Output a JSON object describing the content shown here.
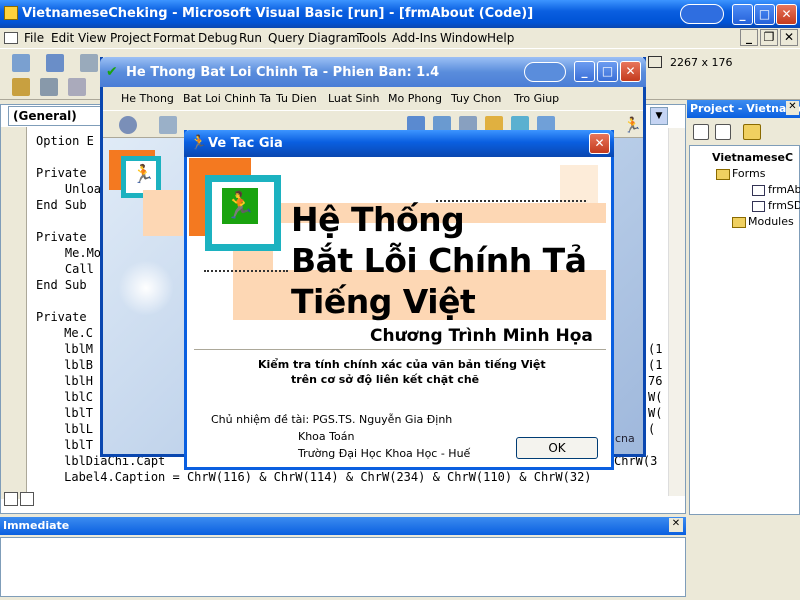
{
  "vb_window": {
    "title": "VietnameseCheking - Microsoft Visual Basic [run] - [frmAbout (Code)]",
    "menu": [
      "File",
      "Edit",
      "View",
      "Project",
      "Format",
      "Debug",
      "Run",
      "Query",
      "Diagram",
      "Tools",
      "Add-Ins",
      "Window",
      "Help"
    ],
    "size_readout": "2267 x 176"
  },
  "code_window": {
    "object_combo": "(General)",
    "lines": [
      "Option E",
      "",
      "Private",
      "    Unloa",
      "End Sub",
      "",
      "Private",
      "    Me.Mo",
      "    Call",
      "End Sub",
      "",
      "Private",
      "     Me.C",
      "     lblM",
      "     lblB",
      "     lblH",
      "     lblC",
      "     lblT",
      "     lblL",
      "     lblT",
      "     lblDiaChi.Capt",
      "     Label4.Caption = ChrW(116) & ChrW(114) & ChrW(234) & ChrW(110) & ChrW(32)"
    ],
    "right_fragments": [
      "(1",
      "(1",
      "76",
      "W(",
      "W(",
      "(",
      "ChrW(3"
    ]
  },
  "project_panel": {
    "title": "Project - VietnameseCheking",
    "tree": [
      "VietnameseC",
      "Forms",
      "frmAbo",
      "frmSD",
      "Modules"
    ]
  },
  "immediate": {
    "title": "Immediate"
  },
  "app_window": {
    "title": "He Thong Bat Loi Chinh Ta - Phien Ban: 1.4",
    "menu": [
      "He Thong",
      "Bat Loi Chinh Ta",
      "Tu Dien",
      "Luat Sinh",
      "Mo Phong",
      "Tuy Chon",
      "Tro Giup"
    ],
    "canvas_fragment": "cna"
  },
  "about_dialog": {
    "title": "Ve Tac Gia",
    "heading": [
      "Hệ Thống",
      "Bắt Lỗi Chính Tả",
      "Tiếng Việt"
    ],
    "subtitle": "Chương Trình Minh Họa",
    "description": [
      "Kiểm tra tính chính xác của văn bản tiếng Việt",
      "trên cơ sở độ liên kết chặt chẽ"
    ],
    "credit_label": "Chủ nhiệm đề tài: PGS.TS. Nguyễn Gia Định",
    "credit_lines": [
      "Khoa Toán",
      "Trường Đại Học Khoa Học - Huế"
    ],
    "ok_label": "OK"
  },
  "colors": {
    "xp_blue": "#0a5fe0",
    "orange": "#f47920",
    "teal": "#1cb2c0",
    "peach": "#fdd7b4",
    "runner_green": "#1aa30f"
  }
}
